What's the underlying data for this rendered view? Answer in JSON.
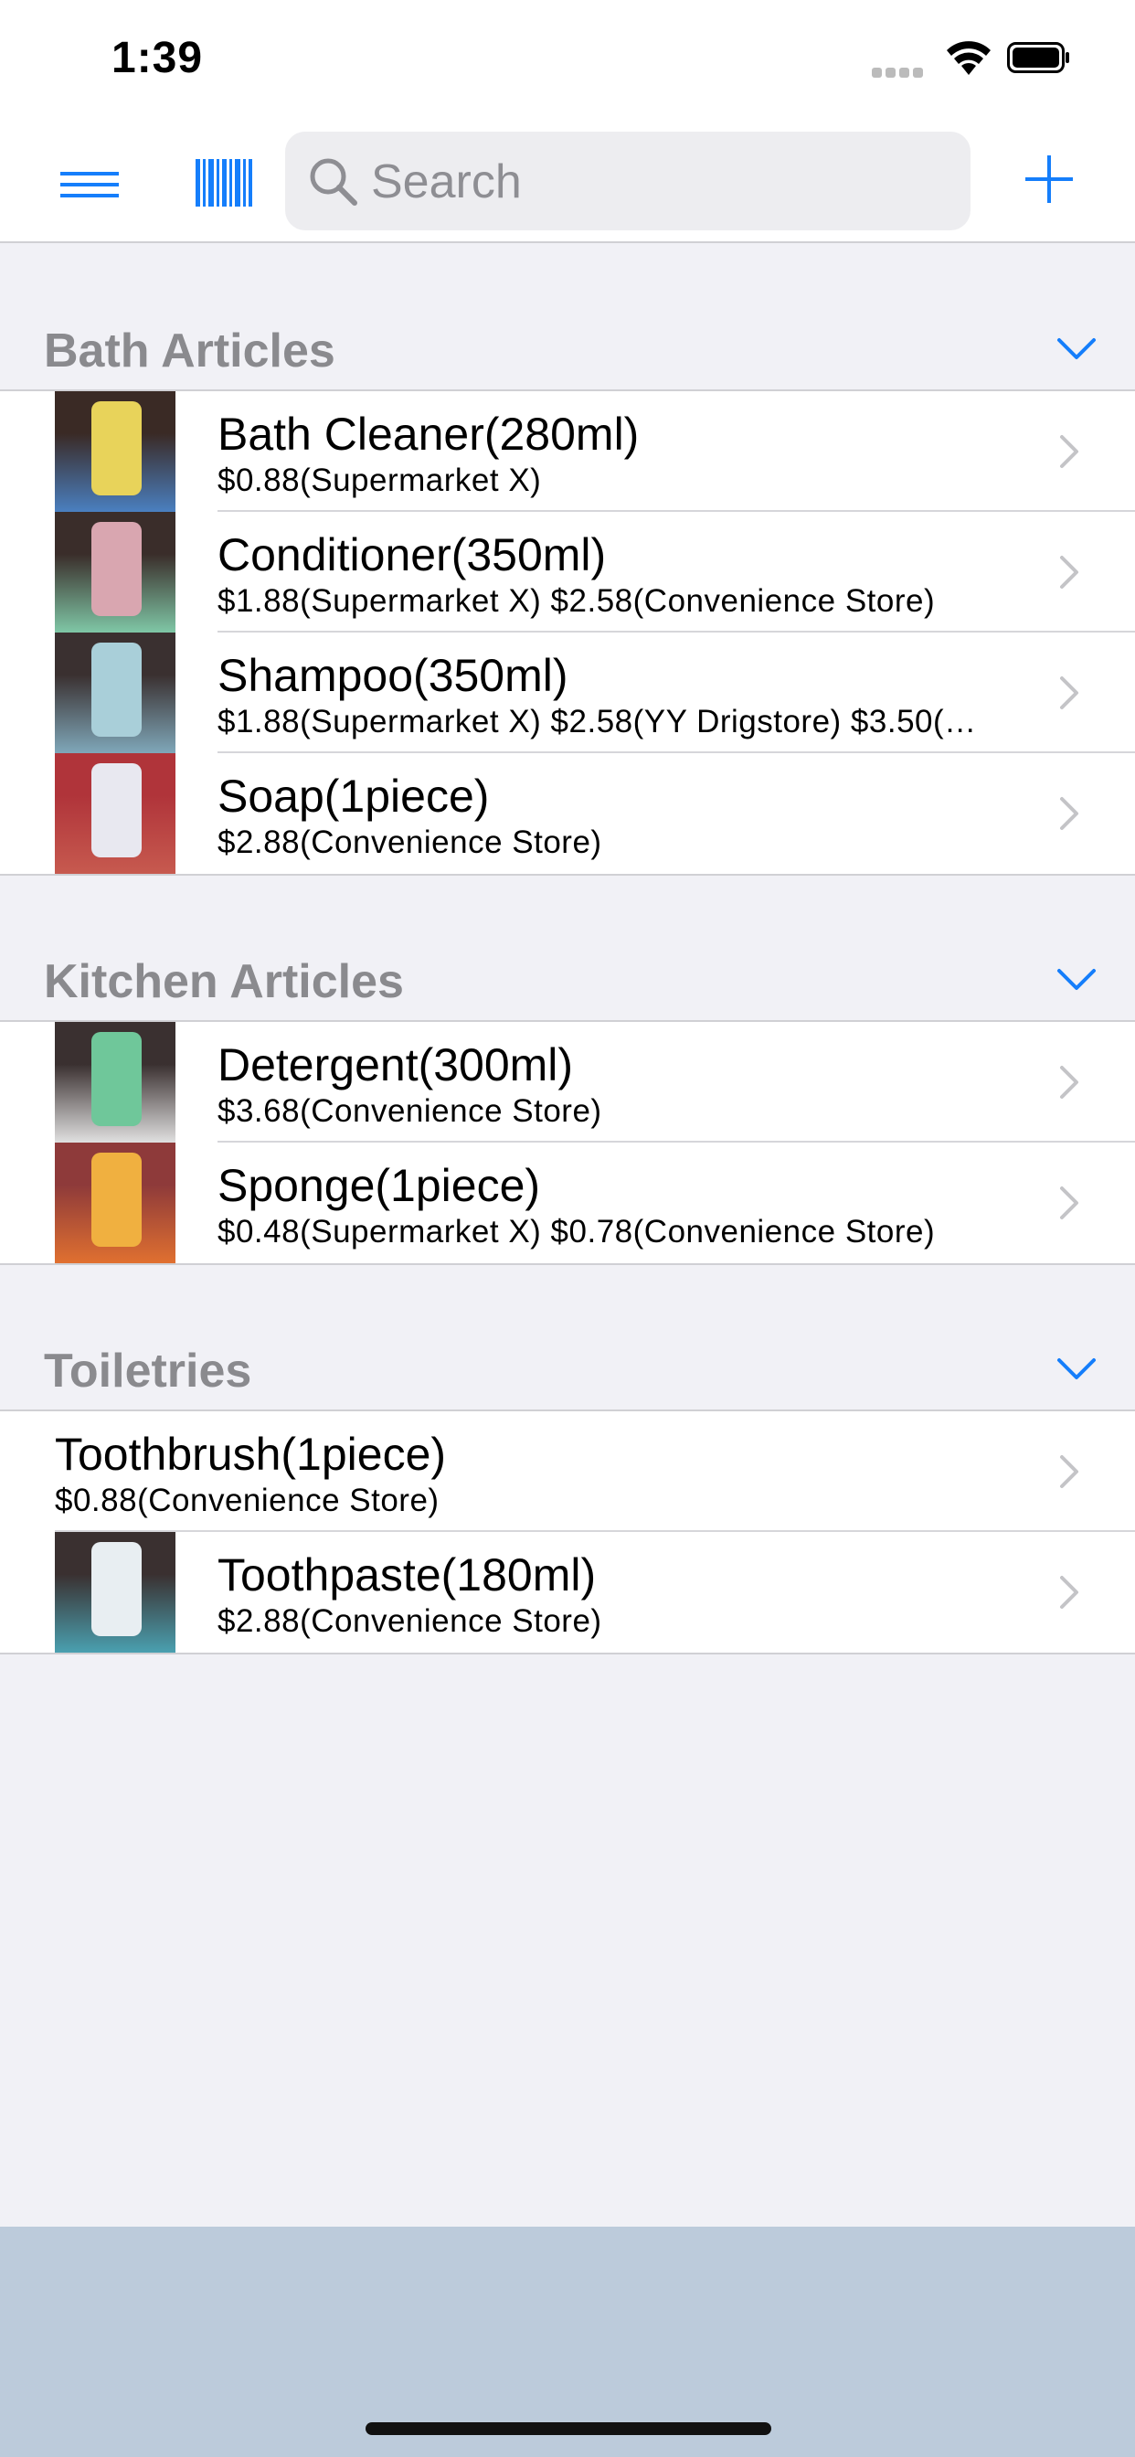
{
  "status_bar": {
    "time": "1:39"
  },
  "nav": {
    "menu_icon": "hamburger-menu-icon",
    "barcode_icon": "barcode-icon",
    "search_placeholder": "Search",
    "add_icon": "plus-icon",
    "accent_color": "#157efb"
  },
  "sections": [
    {
      "title": "Bath Articles",
      "items": [
        {
          "name": "Bath Cleaner(280ml)",
          "prices": "$0.88(Supermarket X)",
          "thumb": "photo"
        },
        {
          "name": "Conditioner(350ml)",
          "prices": "$1.88(Supermarket X) $2.58(Convenience Store)",
          "thumb": "photo"
        },
        {
          "name": "Shampoo(350ml)",
          "prices": "$1.88(Supermarket X) $2.58(YY Drigstore) $3.50(…",
          "thumb": "photo"
        },
        {
          "name": "Soap(1piece)",
          "prices": "$2.88(Convenience Store)",
          "thumb": "photo"
        }
      ]
    },
    {
      "title": "Kitchen Articles",
      "items": [
        {
          "name": "Detergent(300ml)",
          "prices": "$3.68(Convenience Store)",
          "thumb": "photo"
        },
        {
          "name": "Sponge(1piece)",
          "prices": "$0.48(Supermarket X) $0.78(Convenience Store)",
          "thumb": "photo"
        }
      ]
    },
    {
      "title": "Toiletries",
      "items": [
        {
          "name": "Toothbrush(1piece)",
          "prices": "$0.88(Convenience Store)",
          "thumb": "none"
        },
        {
          "name": "Toothpaste(180ml)",
          "prices": "$2.88(Convenience Store)",
          "thumb": "photo"
        }
      ]
    }
  ]
}
